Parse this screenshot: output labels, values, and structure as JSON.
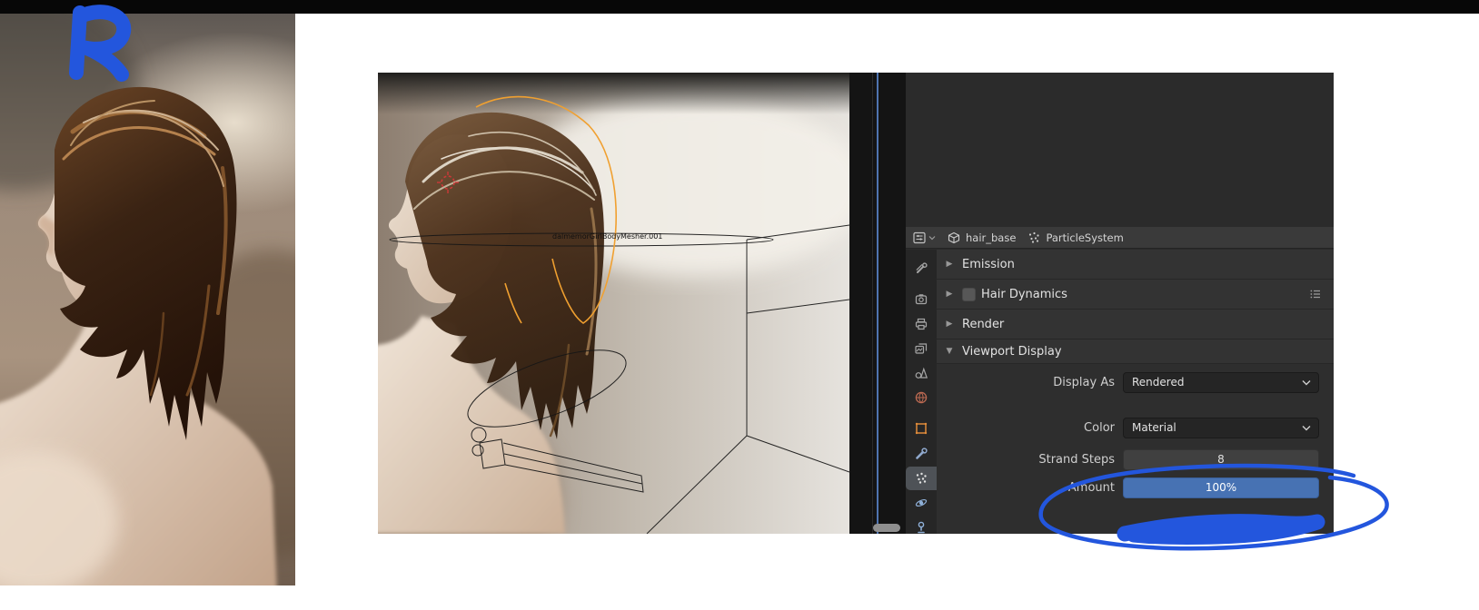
{
  "colors": {
    "annotation_blue": "#2356dd",
    "slider_blue": "#4772b3"
  },
  "viewport": {
    "object_label": "dalmemorGirlBodyMesher.001"
  },
  "properties": {
    "header": {
      "object_name": "hair_base",
      "particle_system_name": "ParticleSystem"
    },
    "tabs": [
      {
        "icon": "tool-icon",
        "active": false
      },
      {
        "icon": "render-icon",
        "active": false
      },
      {
        "icon": "output-icon",
        "active": false
      },
      {
        "icon": "view-layer-icon",
        "active": false
      },
      {
        "icon": "scene-icon",
        "active": false
      },
      {
        "icon": "world-icon",
        "active": false
      },
      {
        "icon": "object-icon",
        "active": false
      },
      {
        "icon": "modifiers-icon",
        "active": false
      },
      {
        "icon": "particles-icon",
        "active": true
      },
      {
        "icon": "physics-icon",
        "active": false
      },
      {
        "icon": "constraints-icon",
        "active": false
      }
    ],
    "panels": [
      {
        "label": "Emission",
        "caret": "▶"
      },
      {
        "label": "Hair Dynamics",
        "caret": "▶",
        "checkbox_checked": false
      },
      {
        "label": "Render",
        "caret": "▶"
      },
      {
        "label": "Viewport Display",
        "caret": "▼"
      }
    ],
    "fields": {
      "display_as": {
        "label": "Display As",
        "value": "Rendered"
      },
      "color": {
        "label": "Color",
        "value": "Material"
      },
      "strand_steps": {
        "label": "Strand Steps",
        "value": "8"
      },
      "amount": {
        "label": "Amount",
        "value": "100%"
      }
    }
  }
}
